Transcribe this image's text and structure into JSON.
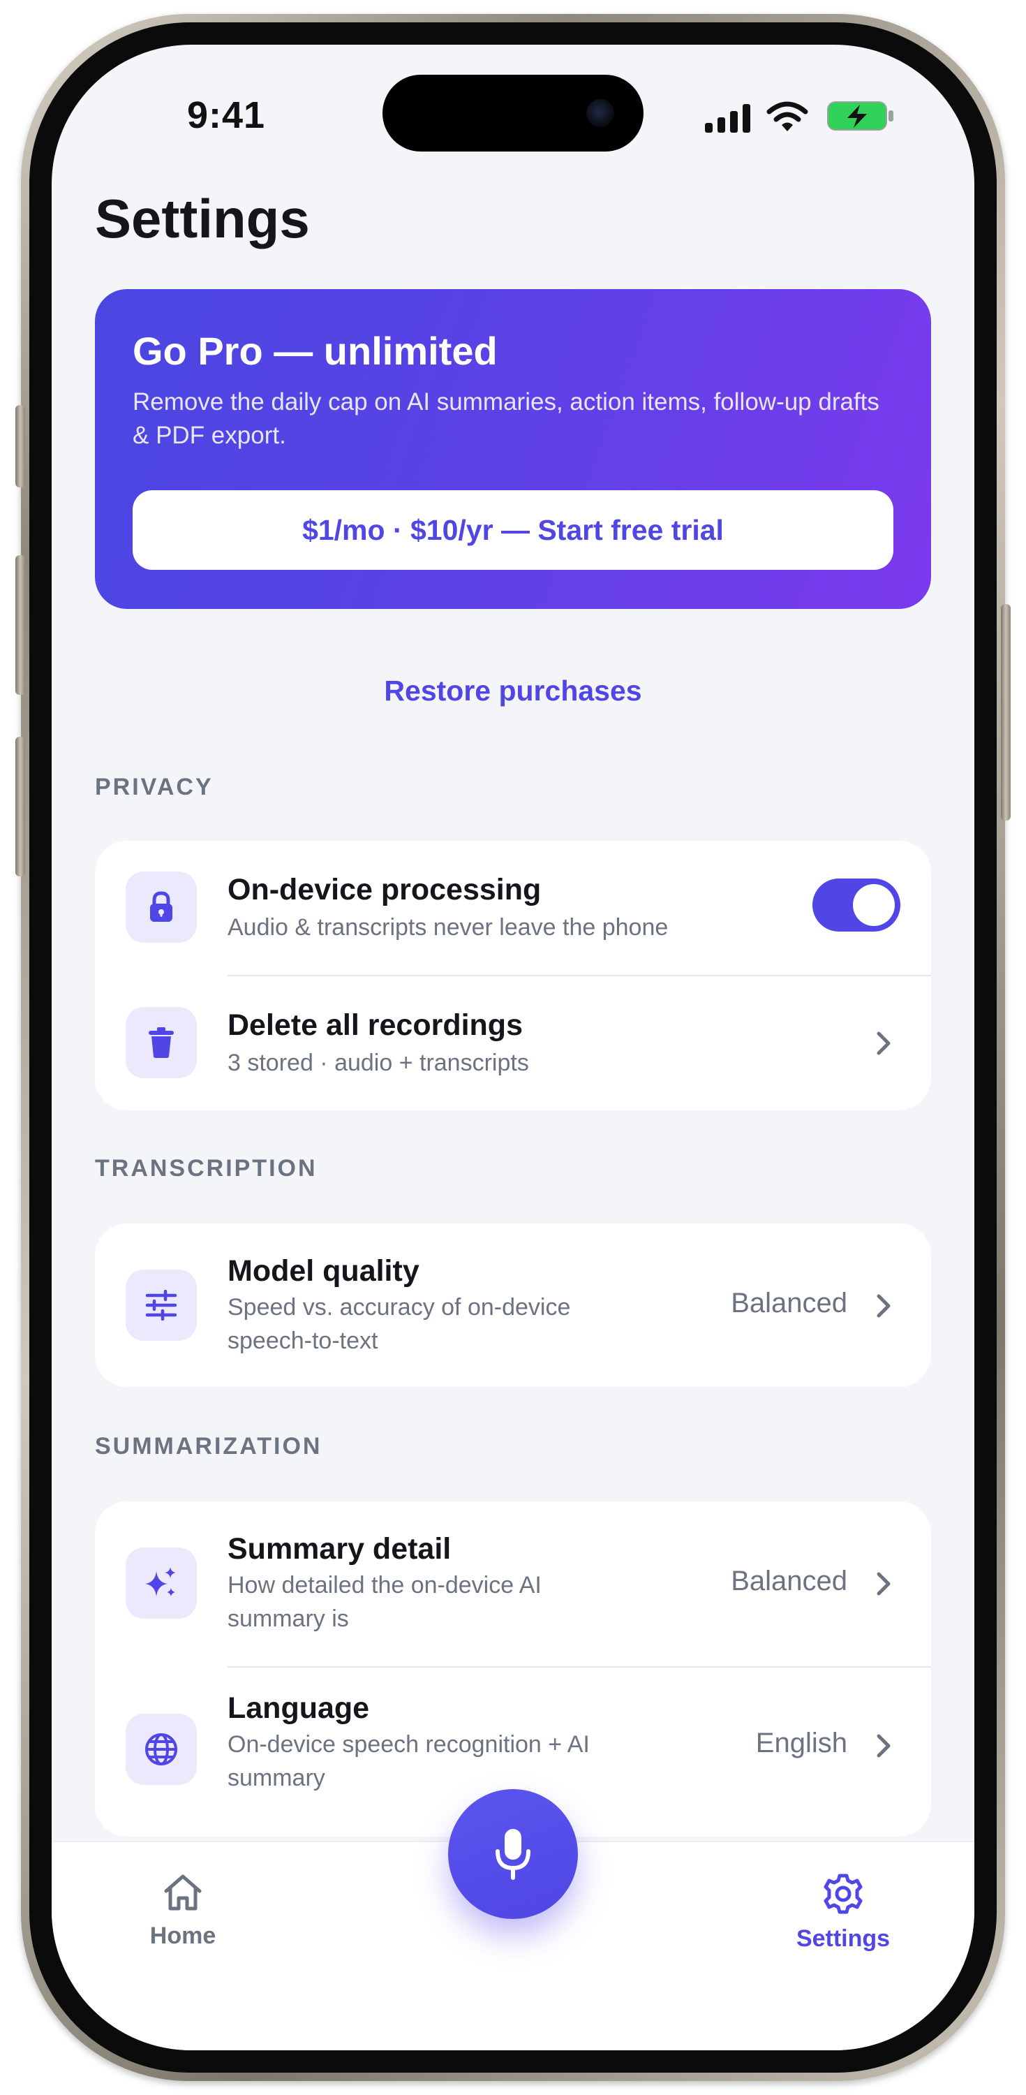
{
  "status_bar": {
    "time": "9:41"
  },
  "page": {
    "title": "Settings"
  },
  "promo": {
    "title": "Go Pro — unlimited",
    "description": "Remove the daily cap on AI summaries, action items, follow-up drafts & PDF export.",
    "cta": "$1/mo · $10/yr — Start free trial"
  },
  "restore_label": "Restore purchases",
  "sections": {
    "privacy": {
      "header": "PRIVACY",
      "on_device": {
        "title": "On-device processing",
        "subtitle": "Audio & transcripts never leave the phone",
        "enabled": true
      },
      "delete_all": {
        "title": "Delete all recordings",
        "subtitle": "3 stored · audio + transcripts"
      }
    },
    "transcription": {
      "header": "TRANSCRIPTION",
      "model_quality": {
        "title": "Model quality",
        "subtitle_line1": "Speed vs. accuracy of on-device",
        "subtitle_line2": "speech-to-text",
        "value": "Balanced"
      }
    },
    "summarization": {
      "header": "SUMMARIZATION",
      "summary_detail": {
        "title": "Summary detail",
        "subtitle_line1": "How detailed the on-device AI",
        "subtitle_line2": "summary is",
        "value": "Balanced"
      },
      "language": {
        "title": "Language",
        "subtitle_line1": "On-device speech recognition + AI",
        "subtitle_line2": "summary",
        "value": "English"
      }
    }
  },
  "tabbar": {
    "home": "Home",
    "settings": "Settings",
    "active": "settings"
  },
  "colors": {
    "accent": "#4f46e5",
    "accent_end": "#7c3aed",
    "icon_bg": "#ece9fd",
    "muted": "#6b7280"
  }
}
